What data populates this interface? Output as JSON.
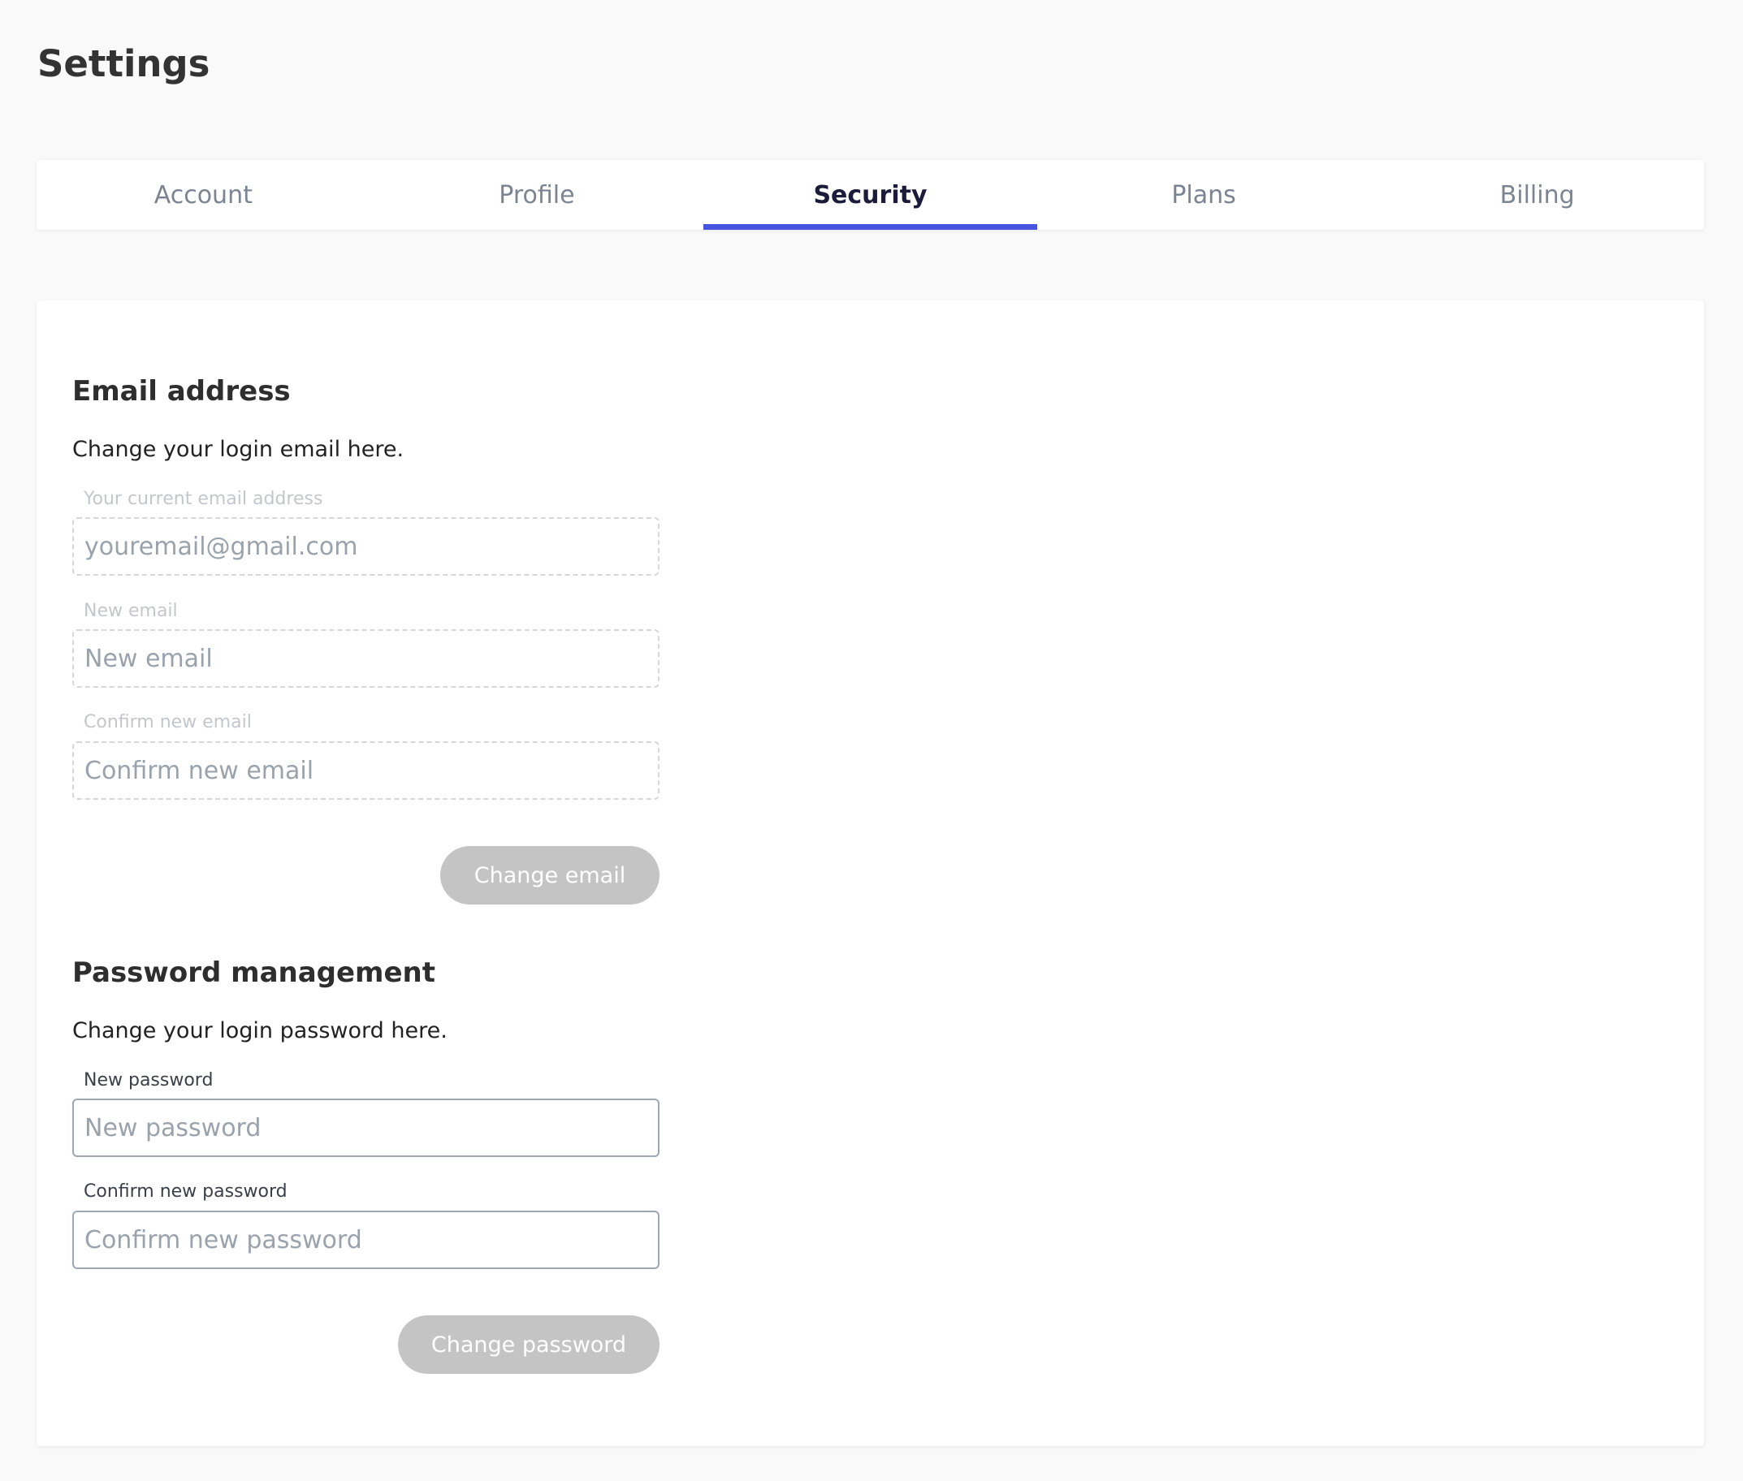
{
  "page": {
    "title": "Settings"
  },
  "tabs": [
    {
      "label": "Account"
    },
    {
      "label": "Profile"
    },
    {
      "label": "Security"
    },
    {
      "label": "Plans"
    },
    {
      "label": "Billing"
    }
  ],
  "active_tab": "Security",
  "email_section": {
    "heading": "Email address",
    "description": "Change your login email here.",
    "current_email_label": "Your current email address",
    "current_email_placeholder": "youremail@gmail.com",
    "new_email_label": "New email",
    "new_email_placeholder": "New email",
    "confirm_email_label": "Confirm new email",
    "confirm_email_placeholder": "Confirm new email",
    "button_label": "Change email"
  },
  "password_section": {
    "heading": "Password management",
    "description": "Change your login password here.",
    "new_password_label": "New password",
    "new_password_placeholder": "New password",
    "confirm_password_label": "Confirm new password",
    "confirm_password_placeholder": "Confirm new password",
    "button_label": "Change password"
  },
  "colors": {
    "accent": "#4654e0",
    "button_disabled_bg": "#c4c4c4",
    "page_bg": "#f9f9f9"
  }
}
